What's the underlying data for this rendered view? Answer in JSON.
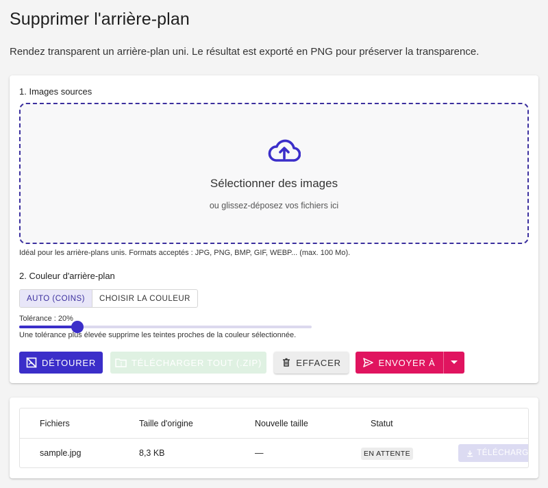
{
  "page": {
    "title": "Supprimer l'arrière-plan",
    "subtitle": "Rendez transparent un arrière-plan uni. Le résultat est exporté en PNG pour préserver la transparence."
  },
  "sources": {
    "label": "1. Images sources",
    "dropzone_title": "Sélectionner des images",
    "dropzone_subtitle": "ou glissez-déposez vos fichiers ici",
    "hint": "Idéal pour les arrière-plans unis. Formats acceptés : JPG, PNG, BMP, GIF, WEBP... (max. 100 Mo).",
    "icon": "cloud-upload-icon"
  },
  "background": {
    "label": "2. Couleur d'arrière-plan",
    "options": [
      "AUTO (COINS)",
      "CHOISIR LA COULEUR"
    ],
    "selected": "AUTO (COINS)"
  },
  "tolerance": {
    "label": "Tolérance : 20%",
    "value_percent": 20,
    "hint": "Une tolérance plus élevée supprime les teintes proches de la couleur sélectionnée."
  },
  "actions": {
    "detourer": "DÉTOURER",
    "download_all": "TÉLÉCHARGER TOUT (.ZIP)",
    "clear": "EFFACER",
    "send": "ENVOYER À"
  },
  "table": {
    "headers": [
      "Fichiers",
      "Taille d'origine",
      "Nouvelle taille",
      "Statut"
    ],
    "rows": [
      {
        "file": "sample.jpg",
        "original_size": "8,3 KB",
        "new_size": "—",
        "status": "EN ATTENTE",
        "download": "TÉLÉCHARGER"
      }
    ]
  },
  "colors": {
    "primary": "#3b2ec9",
    "accent": "#e0145f",
    "success_disabled": "#dff1e2"
  }
}
